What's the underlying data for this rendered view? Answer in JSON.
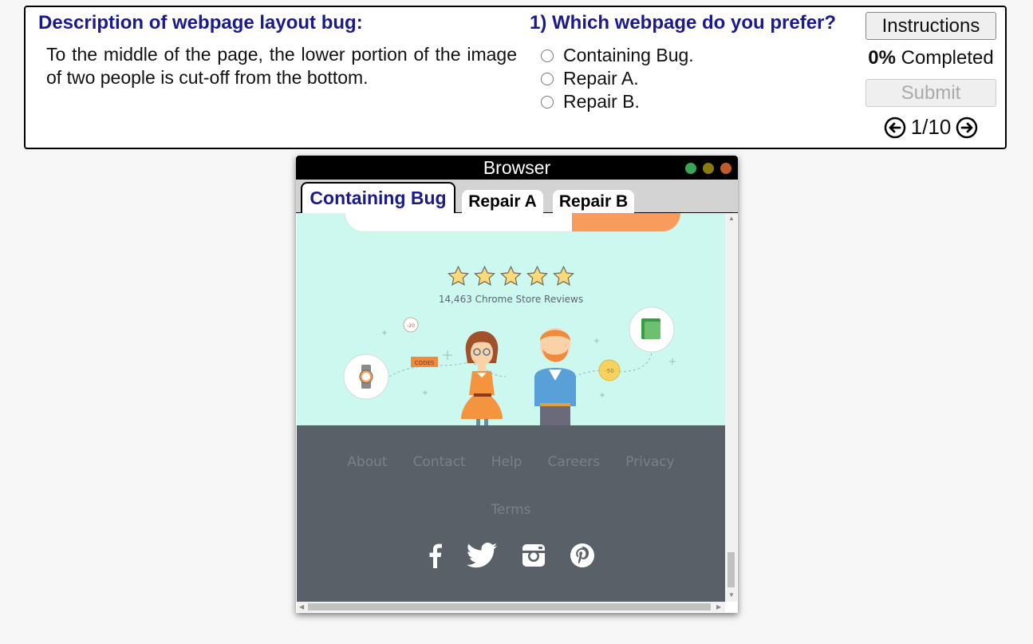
{
  "task": {
    "description_title": "Description of webpage layout bug:",
    "description_text": "To the middle of the page, the lower portion of the image of two people is cut-off from the bottom.",
    "question": "1) Which webpage do you prefer?",
    "options": [
      "Containing Bug.",
      "Repair A.",
      "Repair B."
    ],
    "instructions_label": "Instructions",
    "progress_percent": "0%",
    "progress_label": "Completed",
    "submit_label": "Submit",
    "page_counter": "1/10"
  },
  "browser": {
    "title": "Browser",
    "tabs": [
      "Containing Bug",
      "Repair A",
      "Repair B"
    ],
    "active_tab": "Containing Bug",
    "window_dots": [
      "#3aa655",
      "#8a7a10",
      "#c05a28"
    ]
  },
  "page": {
    "rating_stars": 5,
    "reviews_text": "14,463 Chrome Store Reviews",
    "illustration_labels": [
      "CODES",
      "-20",
      "-50"
    ],
    "footer_links": [
      "About",
      "Contact",
      "Help",
      "Careers",
      "Privacy"
    ],
    "footer_terms": "Terms",
    "social_icons": [
      "facebook-icon",
      "twitter-icon",
      "instagram-icon",
      "pinterest-icon"
    ]
  }
}
